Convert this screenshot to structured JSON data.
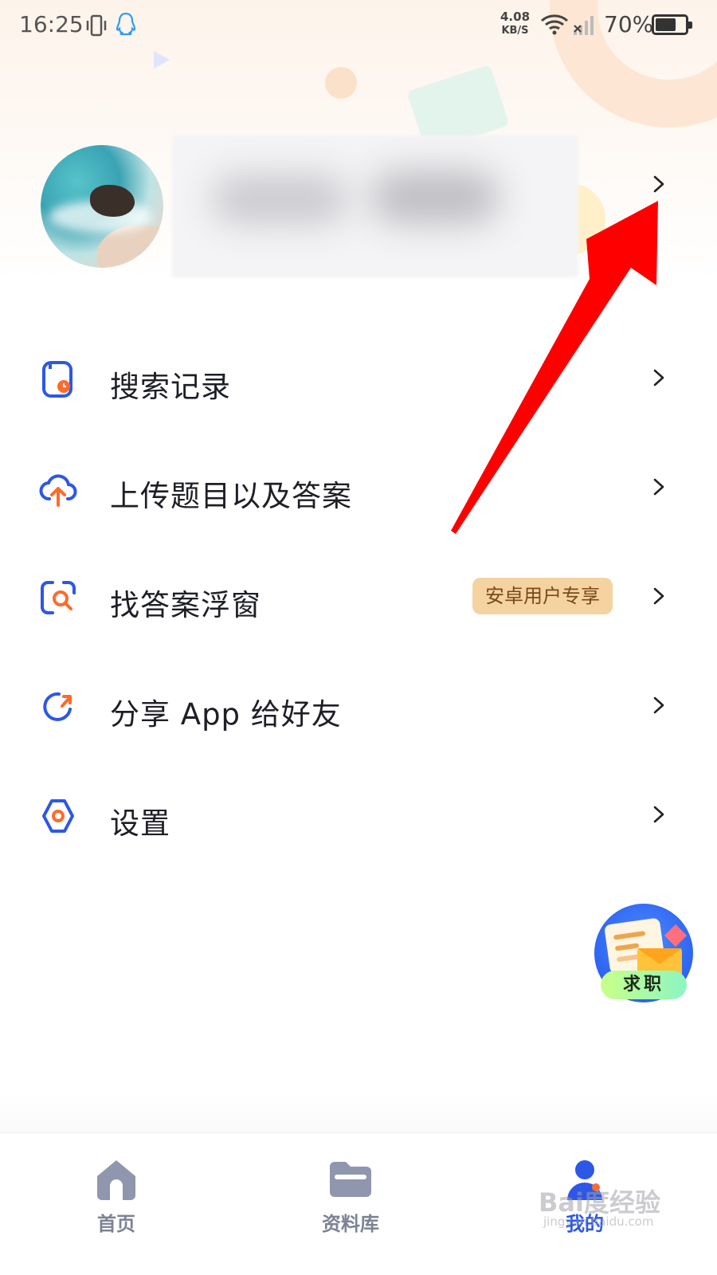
{
  "status_bar": {
    "time": "16:25",
    "net_speed_value": "4.08",
    "net_speed_unit": "KB/S",
    "battery_pct": "70%",
    "battery_level": 0.7
  },
  "profile": {
    "avatar": "avatar-beach-photo",
    "name": ""
  },
  "menu": {
    "items": [
      {
        "label": "搜索记录",
        "icon": "search-history-icon"
      },
      {
        "label": "上传题目以及答案",
        "icon": "cloud-upload-icon"
      },
      {
        "label": "找答案浮窗",
        "icon": "floating-search-icon",
        "badge": "安卓用户专享"
      },
      {
        "label": "分享 App 给好友",
        "icon": "share-icon"
      },
      {
        "label": "设置",
        "icon": "gear-icon"
      }
    ]
  },
  "job_fab": {
    "label": "求职"
  },
  "bottom_nav": {
    "items": [
      {
        "label": "首页",
        "icon": "home-icon"
      },
      {
        "label": "资料库",
        "icon": "folder-icon"
      },
      {
        "label": "我的",
        "icon": "profile-icon",
        "active": true
      }
    ]
  },
  "watermark": {
    "text": "Bai度经验",
    "sub": "jingyan.baidu.com"
  },
  "colors": {
    "accent": "#2d57e6",
    "icon_orange": "#ff6a2b",
    "badge_bg": "#f4d3a1",
    "arrow": "#ff0000"
  }
}
